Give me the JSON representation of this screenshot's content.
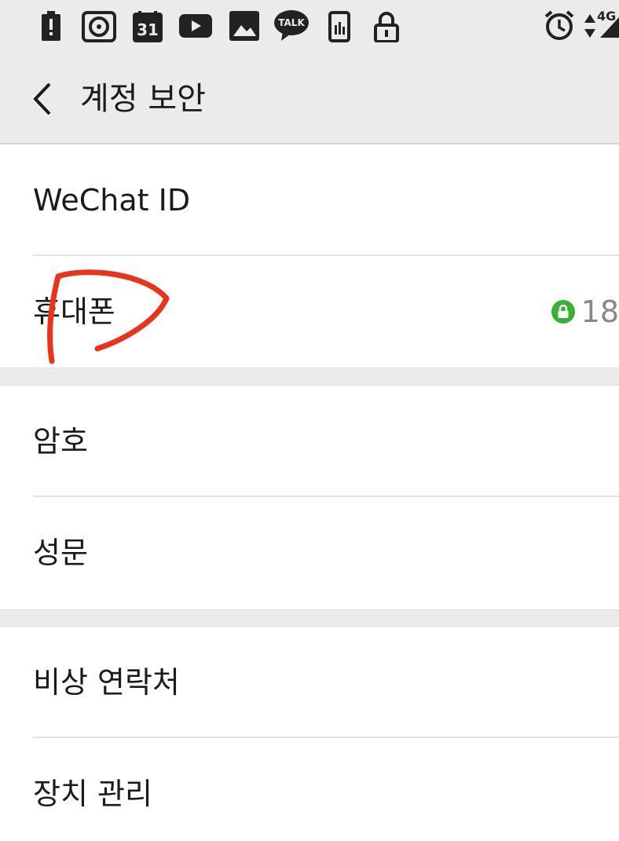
{
  "status_bar": {
    "calendar_day": "31",
    "talk_label": "TALK",
    "network_label": "4G",
    "icons": [
      "battery-alert-icon",
      "vinyl-icon",
      "calendar-icon",
      "youtube-icon",
      "gallery-icon",
      "kakaotalk-icon",
      "phone-stats-icon",
      "lock-icon",
      "alarm-icon",
      "data-arrows-icon",
      "signal-icon"
    ]
  },
  "toolbar": {
    "title": "계정 보안",
    "back_icon": "chevron-left-icon"
  },
  "groups": [
    {
      "items": [
        {
          "label": "WeChat ID"
        },
        {
          "label": "휴대폰",
          "value": "18",
          "value_icon": "lock-badge-icon"
        }
      ]
    },
    {
      "items": [
        {
          "label": "암호"
        },
        {
          "label": "성문"
        }
      ]
    },
    {
      "items": [
        {
          "label": "비상 연락처"
        },
        {
          "label": "장치 관리"
        }
      ]
    }
  ],
  "colors": {
    "background_gray": "#ebebeb",
    "lock_badge": "#3cb034",
    "scribble_red": "#e8341c"
  }
}
